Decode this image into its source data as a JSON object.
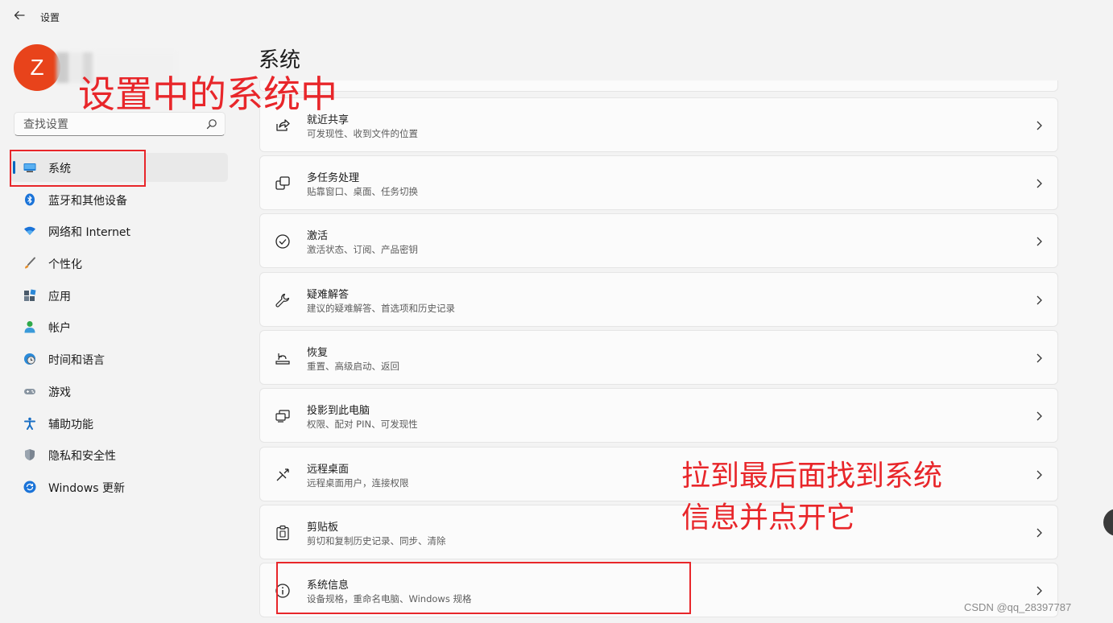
{
  "window": {
    "title": "设置"
  },
  "profile": {
    "avatar_letter": "Z"
  },
  "search": {
    "placeholder": "查找设置"
  },
  "page": {
    "title": "系统"
  },
  "sidebar": {
    "items": [
      {
        "label": "系统",
        "icon": "monitor-icon",
        "active": true
      },
      {
        "label": "蓝牙和其他设备",
        "icon": "bluetooth-icon"
      },
      {
        "label": "网络和 Internet",
        "icon": "wifi-icon"
      },
      {
        "label": "个性化",
        "icon": "brush-icon"
      },
      {
        "label": "应用",
        "icon": "apps-icon"
      },
      {
        "label": "帐户",
        "icon": "person-icon"
      },
      {
        "label": "时间和语言",
        "icon": "globe-clock-icon"
      },
      {
        "label": "游戏",
        "icon": "gamepad-icon"
      },
      {
        "label": "辅助功能",
        "icon": "accessibility-icon"
      },
      {
        "label": "隐私和安全性",
        "icon": "shield-icon"
      },
      {
        "label": "Windows 更新",
        "icon": "update-icon"
      }
    ]
  },
  "settings": [
    {
      "title": "就近共享",
      "subtitle": "可发现性、收到文件的位置",
      "icon": "share-icon"
    },
    {
      "title": "多任务处理",
      "subtitle": "贴靠窗口、桌面、任务切换",
      "icon": "multitask-icon"
    },
    {
      "title": "激活",
      "subtitle": "激活状态、订阅、产品密钥",
      "icon": "check-circle-icon"
    },
    {
      "title": "疑难解答",
      "subtitle": "建议的疑难解答、首选项和历史记录",
      "icon": "wrench-icon"
    },
    {
      "title": "恢复",
      "subtitle": "重置、高级启动、返回",
      "icon": "recovery-icon"
    },
    {
      "title": "投影到此电脑",
      "subtitle": "权限、配对 PIN、可发现性",
      "icon": "projection-icon"
    },
    {
      "title": "远程桌面",
      "subtitle": "远程桌面用户，连接权限",
      "icon": "remote-desktop-icon"
    },
    {
      "title": "剪贴板",
      "subtitle": "剪切和复制历史记录、同步、清除",
      "icon": "clipboard-icon"
    },
    {
      "title": "系统信息",
      "subtitle": "设备规格，重命名电脑、Windows 规格",
      "icon": "info-icon"
    }
  ],
  "annotations": {
    "top": "设置中的系统中",
    "right_line1": "拉到最后面找到系统",
    "right_line2": "信息并点开它",
    "color": "#e8262a"
  },
  "watermark": "CSDN @qq_28397787",
  "colors": {
    "accent": "#0067c0",
    "avatar": "#e8431b"
  }
}
